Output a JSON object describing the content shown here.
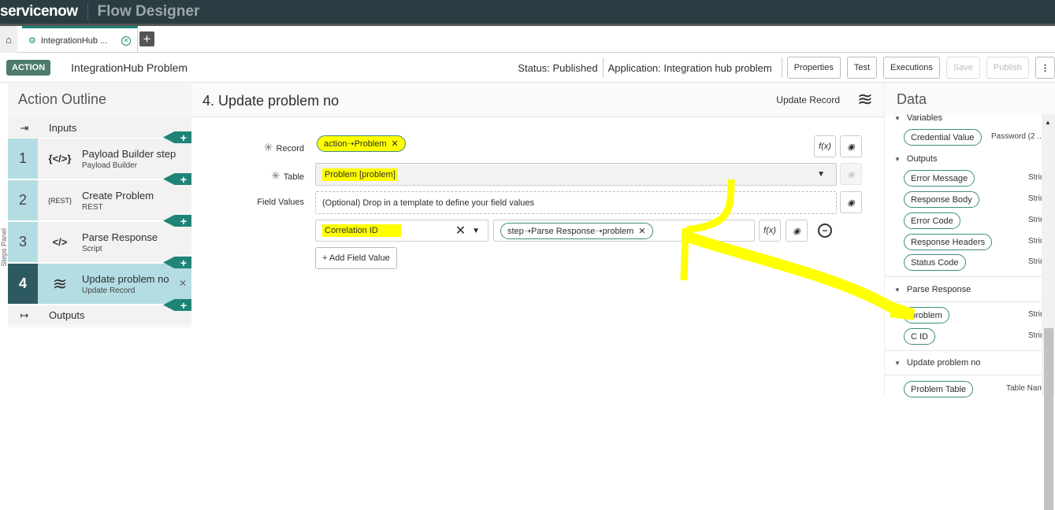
{
  "topbar": {
    "logo": "servicenow",
    "app_title": "Flow Designer"
  },
  "tabs": {
    "home_icon": "home-icon",
    "active_tab": "IntegrationHub ...",
    "add_label": "+"
  },
  "header": {
    "badge": "ACTION",
    "title": "IntegrationHub Problem",
    "status": "Status: Published",
    "application": "Application: Integration hub problem",
    "buttons": {
      "properties": "Properties",
      "test": "Test",
      "executions": "Executions",
      "save": "Save",
      "publish": "Publish"
    }
  },
  "outline": {
    "title": "Action Outline",
    "inputs": "Inputs",
    "outputs": "Outputs",
    "side_label": "Steps Panel",
    "steps": [
      {
        "num": "1",
        "title": "Payload Builder step",
        "type": "Payload Builder",
        "icon": "{</>}"
      },
      {
        "num": "2",
        "title": "Create Problem",
        "type": "REST",
        "icon": "{REST}"
      },
      {
        "num": "3",
        "title": "Parse Response",
        "type": "Script",
        "icon": "</>"
      },
      {
        "num": "4",
        "title": "Update problem no",
        "type": "Update Record",
        "icon": "≋"
      }
    ]
  },
  "step_detail": {
    "title": "4.  Update problem no",
    "type": "Update Record",
    "record_label": "Record",
    "record_value": "action➝Problem",
    "table_label": "Table",
    "table_value": "Problem [problem]",
    "field_values_label": "Field Values",
    "template_placeholder": "(Optional) Drop in a template to define your field values",
    "field_name": "Correlation ID",
    "field_value": "step➝Parse Response➝problem",
    "add_field_value": "+ Add Field Value",
    "fx": "f(x)"
  },
  "data_panel": {
    "title": "Data",
    "variables": "Variables",
    "variable_items": [
      {
        "name": "Credential Value",
        "type": "Password (2 ..."
      }
    ],
    "outputs": "Outputs",
    "output_items": [
      {
        "name": "Error Message",
        "type": "Strin"
      },
      {
        "name": "Response Body",
        "type": "Strin"
      },
      {
        "name": "Error Code",
        "type": "Strin"
      },
      {
        "name": "Response Headers",
        "type": "Strin"
      },
      {
        "name": "Status Code",
        "type": "Strin"
      }
    ],
    "parse_response": "Parse Response",
    "parse_items": [
      {
        "name": "problem",
        "type": "Strin"
      },
      {
        "name": "C ID",
        "type": "Strin"
      }
    ],
    "update_problem": "Update problem no",
    "update_items": [
      {
        "name": "Problem Table",
        "type": "Table Nam"
      }
    ]
  },
  "colors": {
    "topbar": "#2b3d42",
    "accent": "#1f8476",
    "step_bg": "#b3dde3",
    "highlight": "#ffff00"
  }
}
